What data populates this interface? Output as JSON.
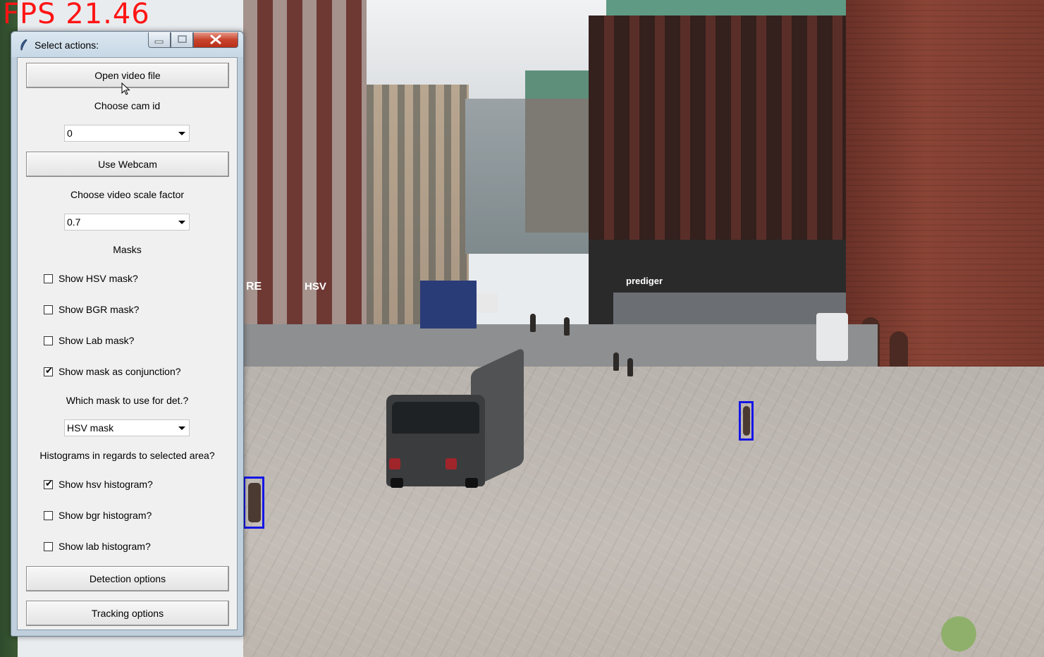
{
  "overlay": {
    "fps_text": "FPS 21.46"
  },
  "scene": {
    "shop_sign": "prediger",
    "left_sign_1": "RE",
    "left_sign_2": "HSV",
    "detection_box_color": "#1416e6"
  },
  "window": {
    "title": "Select actions:",
    "controls": {
      "minimize": "—",
      "maximize": "□",
      "close": "✕"
    }
  },
  "form": {
    "open_video_button": "Open video file",
    "cam_label": "Choose cam id",
    "cam_value": "0",
    "webcam_button": "Use Webcam",
    "scale_label": "Choose video scale factor",
    "scale_value": "0.7",
    "masks_heading": "Masks",
    "masks": [
      {
        "label": "Show HSV mask?",
        "checked": false
      },
      {
        "label": "Show BGR mask?",
        "checked": false
      },
      {
        "label": "Show Lab mask?",
        "checked": false
      },
      {
        "label": "Show mask as conjunction?",
        "checked": true
      }
    ],
    "det_mask_label": "Which mask to use for det.?",
    "det_mask_value": "HSV mask",
    "hist_heading": "Histograms in regards to selected area?",
    "histograms": [
      {
        "label": "Show hsv histogram?",
        "checked": true
      },
      {
        "label": "Show bgr histogram?",
        "checked": false
      },
      {
        "label": "Show lab histogram?",
        "checked": false
      }
    ],
    "detection_button": "Detection options",
    "tracking_button": "Tracking options"
  },
  "colors": {
    "fps_text": "#ff1414",
    "window_frame": "#bfcfdc",
    "close_button": "#c8432c",
    "client_background": "#f0f0f0"
  }
}
